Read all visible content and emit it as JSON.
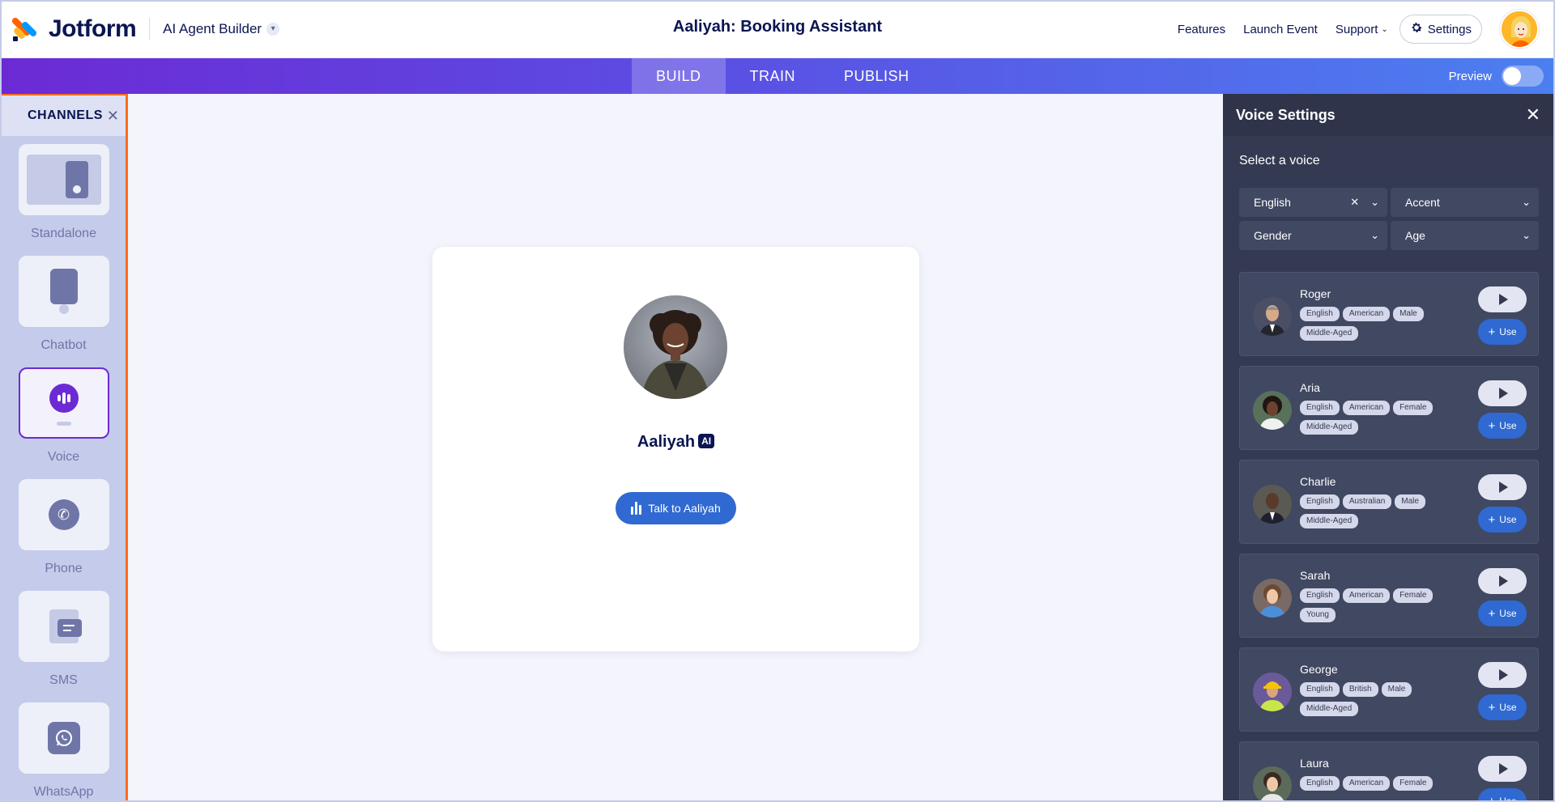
{
  "header": {
    "brand": "Jotform",
    "builder_label": "AI Agent Builder",
    "agent_title": "Aaliyah: Booking Assistant",
    "links": {
      "features": "Features",
      "launch_event": "Launch Event",
      "support": "Support"
    },
    "settings_label": "Settings"
  },
  "nav": {
    "tabs": [
      {
        "label": "BUILD",
        "active": true
      },
      {
        "label": "TRAIN",
        "active": false
      },
      {
        "label": "PUBLISH",
        "active": false
      }
    ],
    "preview_label": "Preview",
    "preview_on": false
  },
  "channels": {
    "title": "CHANNELS",
    "items": [
      {
        "label": "Standalone",
        "icon": "standalone-icon",
        "selected": false
      },
      {
        "label": "Chatbot",
        "icon": "chatbot-icon",
        "selected": false
      },
      {
        "label": "Voice",
        "icon": "voice-icon",
        "selected": true
      },
      {
        "label": "Phone",
        "icon": "phone-icon",
        "selected": false
      },
      {
        "label": "SMS",
        "icon": "sms-icon",
        "selected": false
      },
      {
        "label": "WhatsApp",
        "icon": "whatsapp-icon",
        "selected": false
      }
    ]
  },
  "agent": {
    "name": "Aaliyah",
    "badge": "AI",
    "talk_label": "Talk to Aaliyah"
  },
  "voice_settings": {
    "title": "Voice Settings",
    "subtitle": "Select a voice",
    "filters": {
      "language": "English",
      "accent": "Accent",
      "gender": "Gender",
      "age": "Age"
    },
    "use_label": "Use",
    "voices": [
      {
        "name": "Roger",
        "tags": [
          "English",
          "American",
          "Male",
          "Middle-Aged"
        ]
      },
      {
        "name": "Aria",
        "tags": [
          "English",
          "American",
          "Female",
          "Middle-Aged"
        ]
      },
      {
        "name": "Charlie",
        "tags": [
          "English",
          "Australian",
          "Male",
          "Middle-Aged"
        ]
      },
      {
        "name": "Sarah",
        "tags": [
          "English",
          "American",
          "Female",
          "Young"
        ]
      },
      {
        "name": "George",
        "tags": [
          "English",
          "British",
          "Male",
          "Middle-Aged"
        ]
      },
      {
        "name": "Laura",
        "tags": [
          "English",
          "American",
          "Female"
        ]
      }
    ]
  },
  "colors": {
    "brand_navy": "#0a1551",
    "accent_purple": "#6c2ad5",
    "accent_blue": "#2f69d1",
    "selection_orange": "#ff6b1a",
    "panel_dark": "#343a51"
  }
}
